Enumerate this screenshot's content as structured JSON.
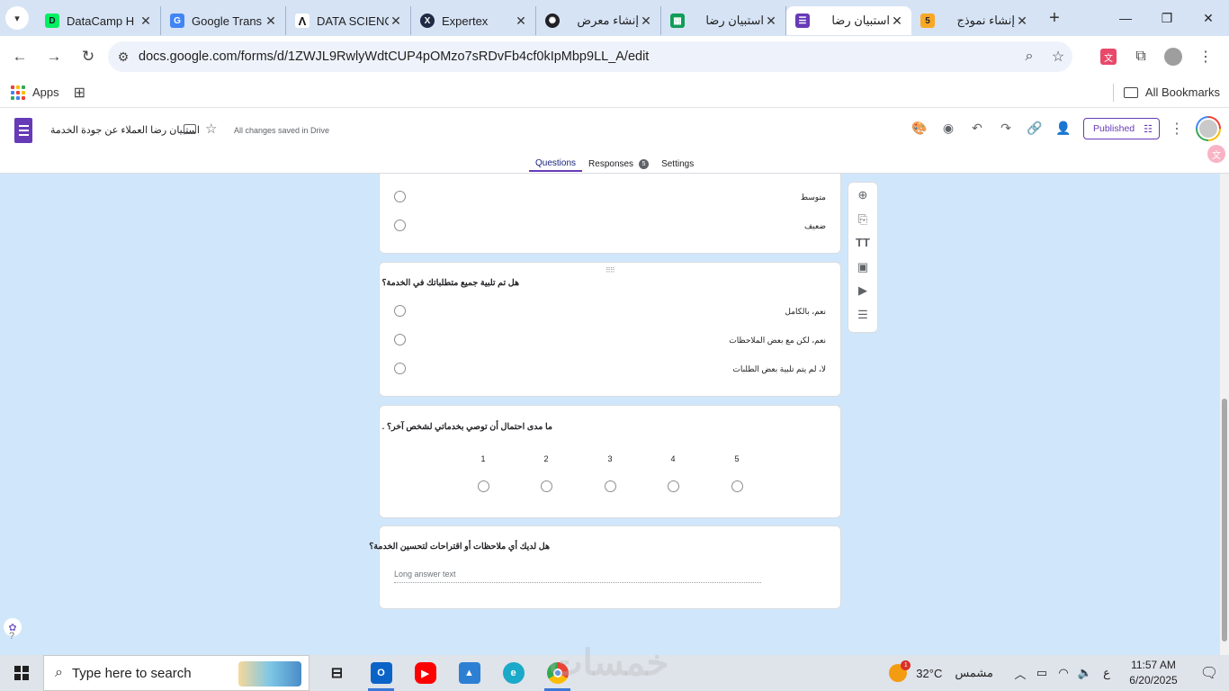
{
  "browser": {
    "tabs": [
      {
        "label": "DataCamp H",
        "icon": "datacamp-icon",
        "color": "#03ef62"
      },
      {
        "label": "Google Trans",
        "icon": "google-translate-icon",
        "color": "#4285f4"
      },
      {
        "label": "DATA SCIENC",
        "icon": "data-science-icon",
        "color": "#111111"
      },
      {
        "label": "Expertex",
        "icon": "expertex-icon",
        "color": "#1f2a44"
      },
      {
        "label": "إنشاء معرض",
        "icon": "openai-icon",
        "color": "#202124"
      },
      {
        "label": "استبيان رضا",
        "icon": "google-sheets-icon",
        "color": "#0f9d58"
      },
      {
        "label": "استبيان رضا",
        "icon": "google-forms-icon",
        "color": "#673ab7",
        "active": true
      },
      {
        "label": "إنشاء نموذج",
        "icon": "number-five-icon",
        "color": "#f9a825"
      }
    ],
    "url": "docs.google.com/forms/d/1ZWJL9RwlyWdtCUP4pOMzo7sRDvFb4cf0kIpMbp9LL_A/edit",
    "bookmarks": {
      "apps": "Apps",
      "all": "All Bookmarks"
    }
  },
  "form": {
    "title": "استبيان رضا العملاء عن جودة الخدمة",
    "saved_status": "All changes saved in Drive",
    "published_label": "Published",
    "tabs": {
      "questions": "Questions",
      "responses": "Responses",
      "responses_count": "5",
      "settings": "Settings"
    },
    "cards": {
      "prev_options": [
        "متوسط",
        "ضعيف"
      ],
      "q_requirements": {
        "title": "هل تم تلبية جميع متطلباتك في الخدمة؟",
        "options": [
          "نعم، بالكامل",
          "نعم، لكن مع بعض الملاحظات",
          "لا، لم يتم تلبية بعض الطلبات"
        ]
      },
      "q_recommend": {
        "title": "ما مدى احتمال أن توصي بخدماتي لشخص آخر؟ .",
        "scale": [
          "1",
          "2",
          "3",
          "4",
          "5"
        ]
      },
      "q_suggestions": {
        "title": "هل لديك أي ملاحظات أو اقتراحات لتحسين الخدمة؟",
        "placeholder": "Long answer text"
      }
    }
  },
  "taskbar": {
    "search_placeholder": "Type here to search",
    "weather_temp": "32°C",
    "weather_desc": "مشمس",
    "weather_badge": "1",
    "lang": "ع",
    "time": "11:57 AM",
    "date": "6/20/2025"
  },
  "colors": {
    "accent": "#673ab7",
    "background": "#d0e7fb"
  }
}
